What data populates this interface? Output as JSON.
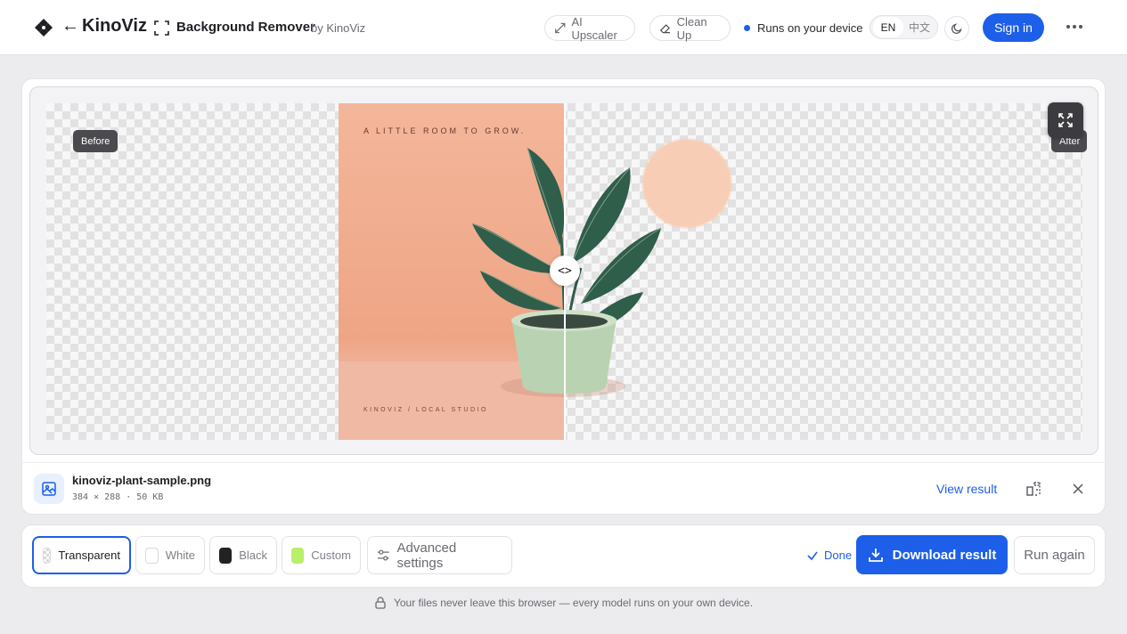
{
  "header": {
    "brand": "KinoViz",
    "back_glyph": "←",
    "tool_title": "Background Remover",
    "tool_by": "by KinoViz",
    "upscaler_label": "AI Upscaler",
    "cleanup_label": "Clean Up",
    "device_label": "Runs on your device",
    "lang_active": "EN",
    "lang_other": "中文",
    "signin_label": "Sign in",
    "icons": {
      "logo": "kinoviz-logo-icon",
      "tool": "frame-icon",
      "upscaler": "expand-arrows-icon",
      "cleanup": "eraser-icon",
      "theme": "moon-icon",
      "more": "more-dots-icon"
    }
  },
  "preview": {
    "before_label": "Before",
    "after_label": "After",
    "poster_headline": "A LITTLE ROOM TO GROW.",
    "poster_footer": "KINOVIZ / LOCAL STUDIO",
    "handle_glyph": "<>",
    "split_ratio": 0.5
  },
  "file": {
    "name": "kinoviz-plant-sample.png",
    "meta": "384 × 288 · 50 KB",
    "view_label": "View result"
  },
  "toolbar": {
    "options": [
      {
        "label": "Transparent"
      },
      {
        "label": "White"
      },
      {
        "label": "Black"
      },
      {
        "label": "Custom"
      }
    ],
    "advanced_label": "Advanced settings",
    "done_label": "Done",
    "download_label": "Download result",
    "run_again_label": "Run again"
  },
  "footer": {
    "privacy": "Your files never leave this browser — every model runs on your own device."
  },
  "colors": {
    "accent": "#1d5fe8",
    "custom_swatch": "#b8ef6b"
  }
}
